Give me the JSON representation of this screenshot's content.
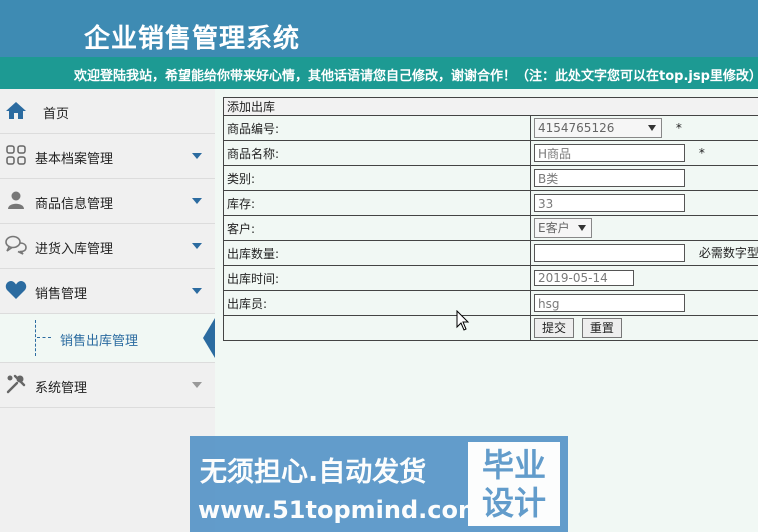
{
  "header": {
    "title": "企业销售管理系统"
  },
  "notice": "欢迎登陆我站，希望能给你带来好心情，其他话语请您自己修改，谢谢合作！（注：此处文字您可以在top.jsp里修改）",
  "sidebar": {
    "items": [
      {
        "label": "首页",
        "icon": "home-icon"
      },
      {
        "label": "基本档案管理",
        "icon": "grid-icon"
      },
      {
        "label": "商品信息管理",
        "icon": "user-icon"
      },
      {
        "label": "进货入库管理",
        "icon": "chat-icon"
      },
      {
        "label": "销售管理",
        "icon": "heart-icon"
      },
      {
        "label": "系统管理",
        "icon": "tools-icon"
      }
    ],
    "submenu": {
      "label": "销售出库管理"
    }
  },
  "form": {
    "heading": "添加出库",
    "rows": [
      {
        "label": "商品编号:",
        "value": "4154765126",
        "star": "*"
      },
      {
        "label": "商品名称:",
        "value": "H商品",
        "star": "*"
      },
      {
        "label": "类别:",
        "value": "B类"
      },
      {
        "label": "库存:",
        "value": "33"
      },
      {
        "label": "客户:",
        "value": "E客户"
      },
      {
        "label": "出库数量:",
        "value": "",
        "hint": "必需数字型"
      },
      {
        "label": "出库时间:",
        "value": "2019-05-14"
      },
      {
        "label": "出库员:",
        "value": "hsg"
      }
    ],
    "submit_label": "提交",
    "reset_label": "重置"
  },
  "watermark": {
    "line1": "无须担心.自动发货",
    "line2": "www.51topmind.com",
    "badge": "毕业设计"
  },
  "colors": {
    "header": "#3e8bb3",
    "notice_bar": "#1d9a93",
    "accent": "#2b6ba0"
  }
}
